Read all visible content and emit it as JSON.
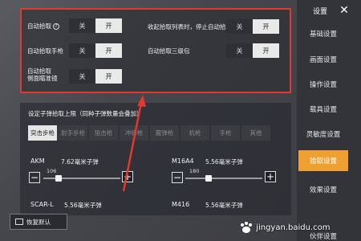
{
  "top_options": {
    "auto_pickup": {
      "label": "自动拾取",
      "off": "关",
      "on": "开"
    },
    "auto_pickup_pistol": {
      "label": "自动拾取手枪",
      "off": "关",
      "on": "开"
    },
    "auto_pickup_side_scope": {
      "label_line1": "自动拾取",
      "label_line2": "侧面瞄准镜",
      "off": "关",
      "on": "开"
    },
    "stop_auto_pickup_on_collapse": {
      "label": "收起拾取列表时，停止自动拾取",
      "off": "关",
      "on": "开"
    },
    "auto_pickup_lv3_backpack": {
      "label": "自动拾取三级包",
      "off": "关",
      "on": "开"
    }
  },
  "ammo_limit": {
    "title": "设定子弹拾取上限（同种子弹数量会叠加）",
    "tabs": [
      "突击步枪",
      "射手步枪",
      "狙击枪",
      "冲锋枪",
      "霰弹枪",
      "机枪",
      "手枪",
      "其他"
    ],
    "guns": [
      {
        "name": "AKM",
        "ammo": "7.62毫米子弹",
        "value": "106",
        "fraction": 0.2
      },
      {
        "name": "M16A4",
        "ammo": "5.56毫米子弹",
        "value": "180",
        "fraction": 0.3
      },
      {
        "name": "SCAR-L",
        "ammo": "5.56毫米子弹"
      },
      {
        "name": "M416",
        "ammo": "5.56毫米子弹"
      }
    ],
    "minus": "−",
    "plus": "+"
  },
  "restore_default": "恢复默认",
  "sidebar": {
    "title": "设置",
    "close": "✕",
    "items": [
      "基础设置",
      "画面设置",
      "操作设置",
      "载具设置",
      "灵敏度设置",
      "拾取设置",
      "效果设置",
      "伙伴设置"
    ],
    "active_index": 5
  },
  "watermark": "jingyan.baidu.com",
  "colors": {
    "highlight": "#e0392e",
    "active_tab": "#f0a030"
  }
}
